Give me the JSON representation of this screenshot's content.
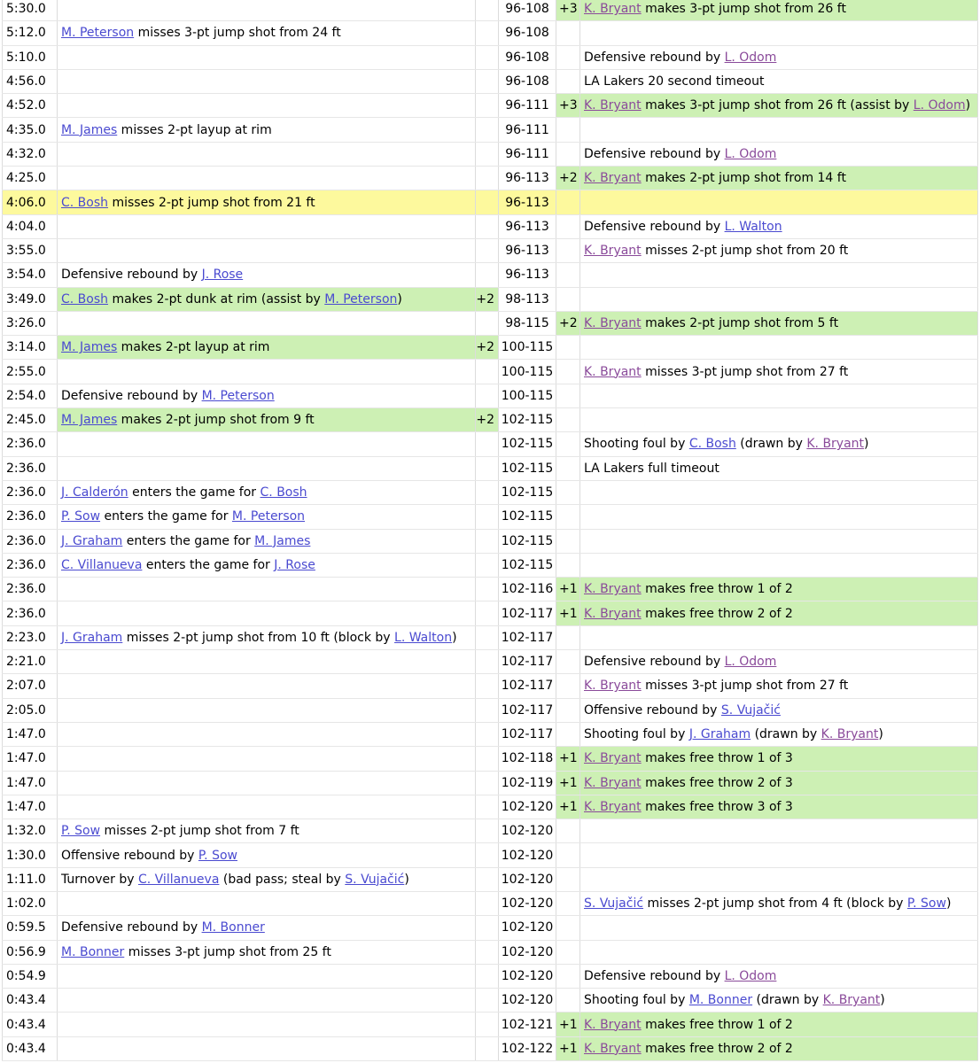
{
  "rows": [
    {
      "time": "5:30.0",
      "away": [],
      "away_pts": "",
      "score": "96-108",
      "home_pts": "+3",
      "home": [
        {
          "p": "K. Bryant",
          "c": "purple"
        },
        {
          "t": " makes 3-pt jump shot from 26 ft"
        }
      ]
    },
    {
      "time": "5:12.0",
      "away": [
        {
          "p": "M. Peterson",
          "c": "blue"
        },
        {
          "t": " misses 3-pt jump shot from 24 ft"
        }
      ],
      "away_pts": "",
      "score": "96-108",
      "home_pts": "",
      "home": []
    },
    {
      "time": "5:10.0",
      "away": [],
      "away_pts": "",
      "score": "96-108",
      "home_pts": "",
      "home": [
        {
          "t": "Defensive rebound by "
        },
        {
          "p": "L. Odom",
          "c": "purple"
        }
      ]
    },
    {
      "time": "4:56.0",
      "away": [],
      "away_pts": "",
      "score": "96-108",
      "home_pts": "",
      "home": [
        {
          "t": "LA Lakers 20 second timeout"
        }
      ]
    },
    {
      "time": "4:52.0",
      "away": [],
      "away_pts": "",
      "score": "96-111",
      "home_pts": "+3",
      "home": [
        {
          "p": "K. Bryant",
          "c": "purple"
        },
        {
          "t": " makes 3-pt jump shot from 26 ft (assist by "
        },
        {
          "p": "L. Odom",
          "c": "purple"
        },
        {
          "t": ")"
        }
      ]
    },
    {
      "time": "4:35.0",
      "away": [
        {
          "p": "M. James",
          "c": "blue"
        },
        {
          "t": " misses 2-pt layup at rim"
        }
      ],
      "away_pts": "",
      "score": "96-111",
      "home_pts": "",
      "home": []
    },
    {
      "time": "4:32.0",
      "away": [],
      "away_pts": "",
      "score": "96-111",
      "home_pts": "",
      "home": [
        {
          "t": "Defensive rebound by "
        },
        {
          "p": "L. Odom",
          "c": "purple"
        }
      ]
    },
    {
      "time": "4:25.0",
      "away": [],
      "away_pts": "",
      "score": "96-113",
      "home_pts": "+2",
      "home": [
        {
          "p": "K. Bryant",
          "c": "purple"
        },
        {
          "t": " makes 2-pt jump shot from 14 ft"
        }
      ]
    },
    {
      "time": "4:06.0",
      "hl": true,
      "away": [
        {
          "p": "C. Bosh",
          "c": "blue"
        },
        {
          "t": " misses 2-pt jump shot from 21 ft"
        }
      ],
      "away_pts": "",
      "score": "96-113",
      "home_pts": "",
      "home": []
    },
    {
      "time": "4:04.0",
      "away": [],
      "away_pts": "",
      "score": "96-113",
      "home_pts": "",
      "home": [
        {
          "t": "Defensive rebound by "
        },
        {
          "p": "L. Walton",
          "c": "blue"
        }
      ]
    },
    {
      "time": "3:55.0",
      "away": [],
      "away_pts": "",
      "score": "96-113",
      "home_pts": "",
      "home": [
        {
          "p": "K. Bryant",
          "c": "purple"
        },
        {
          "t": " misses 2-pt jump shot from 20 ft"
        }
      ]
    },
    {
      "time": "3:54.0",
      "away": [
        {
          "t": "Defensive rebound by "
        },
        {
          "p": "J. Rose",
          "c": "blue"
        }
      ],
      "away_pts": "",
      "score": "96-113",
      "home_pts": "",
      "home": []
    },
    {
      "time": "3:49.0",
      "away": [
        {
          "p": "C. Bosh",
          "c": "blue"
        },
        {
          "t": " makes 2-pt dunk at rim (assist by "
        },
        {
          "p": "M. Peterson",
          "c": "blue"
        },
        {
          "t": ")"
        }
      ],
      "away_pts": "+2",
      "score": "98-113",
      "home_pts": "",
      "home": []
    },
    {
      "time": "3:26.0",
      "away": [],
      "away_pts": "",
      "score": "98-115",
      "home_pts": "+2",
      "home": [
        {
          "p": "K. Bryant",
          "c": "purple"
        },
        {
          "t": " makes 2-pt jump shot from 5 ft"
        }
      ]
    },
    {
      "time": "3:14.0",
      "away": [
        {
          "p": "M. James",
          "c": "blue"
        },
        {
          "t": " makes 2-pt layup at rim"
        }
      ],
      "away_pts": "+2",
      "score": "100-115",
      "home_pts": "",
      "home": []
    },
    {
      "time": "2:55.0",
      "away": [],
      "away_pts": "",
      "score": "100-115",
      "home_pts": "",
      "home": [
        {
          "p": "K. Bryant",
          "c": "purple"
        },
        {
          "t": " misses 3-pt jump shot from 27 ft"
        }
      ]
    },
    {
      "time": "2:54.0",
      "away": [
        {
          "t": "Defensive rebound by "
        },
        {
          "p": "M. Peterson",
          "c": "blue"
        }
      ],
      "away_pts": "",
      "score": "100-115",
      "home_pts": "",
      "home": []
    },
    {
      "time": "2:45.0",
      "away": [
        {
          "p": "M. James",
          "c": "blue"
        },
        {
          "t": " makes 2-pt jump shot from 9 ft"
        }
      ],
      "away_pts": "+2",
      "score": "102-115",
      "home_pts": "",
      "home": []
    },
    {
      "time": "2:36.0",
      "away": [],
      "away_pts": "",
      "score": "102-115",
      "home_pts": "",
      "home": [
        {
          "t": "Shooting foul by "
        },
        {
          "p": "C. Bosh",
          "c": "blue"
        },
        {
          "t": " (drawn by "
        },
        {
          "p": "K. Bryant",
          "c": "purple"
        },
        {
          "t": ")"
        }
      ]
    },
    {
      "time": "2:36.0",
      "away": [],
      "away_pts": "",
      "score": "102-115",
      "home_pts": "",
      "home": [
        {
          "t": "LA Lakers full timeout"
        }
      ]
    },
    {
      "time": "2:36.0",
      "away": [
        {
          "p": "J. Calderón",
          "c": "blue"
        },
        {
          "t": " enters the game for "
        },
        {
          "p": "C. Bosh",
          "c": "blue"
        }
      ],
      "away_pts": "",
      "score": "102-115",
      "home_pts": "",
      "home": []
    },
    {
      "time": "2:36.0",
      "away": [
        {
          "p": "P. Sow",
          "c": "blue"
        },
        {
          "t": " enters the game for "
        },
        {
          "p": "M. Peterson",
          "c": "blue"
        }
      ],
      "away_pts": "",
      "score": "102-115",
      "home_pts": "",
      "home": []
    },
    {
      "time": "2:36.0",
      "away": [
        {
          "p": "J. Graham",
          "c": "blue"
        },
        {
          "t": " enters the game for "
        },
        {
          "p": "M. James",
          "c": "blue"
        }
      ],
      "away_pts": "",
      "score": "102-115",
      "home_pts": "",
      "home": []
    },
    {
      "time": "2:36.0",
      "away": [
        {
          "p": "C. Villanueva",
          "c": "blue"
        },
        {
          "t": " enters the game for "
        },
        {
          "p": "J. Rose",
          "c": "blue"
        }
      ],
      "away_pts": "",
      "score": "102-115",
      "home_pts": "",
      "home": []
    },
    {
      "time": "2:36.0",
      "away": [],
      "away_pts": "",
      "score": "102-116",
      "home_pts": "+1",
      "home": [
        {
          "p": "K. Bryant",
          "c": "purple"
        },
        {
          "t": " makes free throw 1 of 2"
        }
      ]
    },
    {
      "time": "2:36.0",
      "away": [],
      "away_pts": "",
      "score": "102-117",
      "home_pts": "+1",
      "home": [
        {
          "p": "K. Bryant",
          "c": "purple"
        },
        {
          "t": " makes free throw 2 of 2"
        }
      ]
    },
    {
      "time": "2:23.0",
      "away": [
        {
          "p": "J. Graham",
          "c": "blue"
        },
        {
          "t": " misses 2-pt jump shot from 10 ft (block by "
        },
        {
          "p": "L. Walton",
          "c": "blue"
        },
        {
          "t": ")"
        }
      ],
      "away_pts": "",
      "score": "102-117",
      "home_pts": "",
      "home": []
    },
    {
      "time": "2:21.0",
      "away": [],
      "away_pts": "",
      "score": "102-117",
      "home_pts": "",
      "home": [
        {
          "t": "Defensive rebound by "
        },
        {
          "p": "L. Odom",
          "c": "purple"
        }
      ]
    },
    {
      "time": "2:07.0",
      "away": [],
      "away_pts": "",
      "score": "102-117",
      "home_pts": "",
      "home": [
        {
          "p": "K. Bryant",
          "c": "purple"
        },
        {
          "t": " misses 3-pt jump shot from 27 ft"
        }
      ]
    },
    {
      "time": "2:05.0",
      "away": [],
      "away_pts": "",
      "score": "102-117",
      "home_pts": "",
      "home": [
        {
          "t": "Offensive rebound by "
        },
        {
          "p": "S. Vujačić",
          "c": "blue"
        }
      ]
    },
    {
      "time": "1:47.0",
      "away": [],
      "away_pts": "",
      "score": "102-117",
      "home_pts": "",
      "home": [
        {
          "t": "Shooting foul by "
        },
        {
          "p": "J. Graham",
          "c": "blue"
        },
        {
          "t": " (drawn by "
        },
        {
          "p": "K. Bryant",
          "c": "purple"
        },
        {
          "t": ")"
        }
      ]
    },
    {
      "time": "1:47.0",
      "away": [],
      "away_pts": "",
      "score": "102-118",
      "home_pts": "+1",
      "home": [
        {
          "p": "K. Bryant",
          "c": "purple"
        },
        {
          "t": " makes free throw 1 of 3"
        }
      ]
    },
    {
      "time": "1:47.0",
      "away": [],
      "away_pts": "",
      "score": "102-119",
      "home_pts": "+1",
      "home": [
        {
          "p": "K. Bryant",
          "c": "purple"
        },
        {
          "t": " makes free throw 2 of 3"
        }
      ]
    },
    {
      "time": "1:47.0",
      "away": [],
      "away_pts": "",
      "score": "102-120",
      "home_pts": "+1",
      "home": [
        {
          "p": "K. Bryant",
          "c": "purple"
        },
        {
          "t": " makes free throw 3 of 3"
        }
      ]
    },
    {
      "time": "1:32.0",
      "away": [
        {
          "p": "P. Sow",
          "c": "blue"
        },
        {
          "t": " misses 2-pt jump shot from 7 ft"
        }
      ],
      "away_pts": "",
      "score": "102-120",
      "home_pts": "",
      "home": []
    },
    {
      "time": "1:30.0",
      "away": [
        {
          "t": "Offensive rebound by "
        },
        {
          "p": "P. Sow",
          "c": "blue"
        }
      ],
      "away_pts": "",
      "score": "102-120",
      "home_pts": "",
      "home": []
    },
    {
      "time": "1:11.0",
      "away": [
        {
          "t": "Turnover by "
        },
        {
          "p": "C. Villanueva",
          "c": "blue"
        },
        {
          "t": " (bad pass; steal by "
        },
        {
          "p": "S. Vujačić",
          "c": "blue"
        },
        {
          "t": ")"
        }
      ],
      "away_pts": "",
      "score": "102-120",
      "home_pts": "",
      "home": []
    },
    {
      "time": "1:02.0",
      "away": [],
      "away_pts": "",
      "score": "102-120",
      "home_pts": "",
      "home": [
        {
          "p": "S. Vujačić",
          "c": "blue"
        },
        {
          "t": " misses 2-pt jump shot from 4 ft (block by "
        },
        {
          "p": "P. Sow",
          "c": "blue"
        },
        {
          "t": ")"
        }
      ]
    },
    {
      "time": "0:59.5",
      "away": [
        {
          "t": "Defensive rebound by "
        },
        {
          "p": "M. Bonner",
          "c": "blue"
        }
      ],
      "away_pts": "",
      "score": "102-120",
      "home_pts": "",
      "home": []
    },
    {
      "time": "0:56.9",
      "away": [
        {
          "p": "M. Bonner",
          "c": "blue"
        },
        {
          "t": " misses 3-pt jump shot from 25 ft"
        }
      ],
      "away_pts": "",
      "score": "102-120",
      "home_pts": "",
      "home": []
    },
    {
      "time": "0:54.9",
      "away": [],
      "away_pts": "",
      "score": "102-120",
      "home_pts": "",
      "home": [
        {
          "t": "Defensive rebound by "
        },
        {
          "p": "L. Odom",
          "c": "purple"
        }
      ]
    },
    {
      "time": "0:43.4",
      "away": [],
      "away_pts": "",
      "score": "102-120",
      "home_pts": "",
      "home": [
        {
          "t": "Shooting foul by "
        },
        {
          "p": "M. Bonner",
          "c": "blue"
        },
        {
          "t": " (drawn by "
        },
        {
          "p": "K. Bryant",
          "c": "purple"
        },
        {
          "t": ")"
        }
      ]
    },
    {
      "time": "0:43.4",
      "away": [],
      "away_pts": "",
      "score": "102-121",
      "home_pts": "+1",
      "home": [
        {
          "p": "K. Bryant",
          "c": "purple"
        },
        {
          "t": " makes free throw 1 of 2"
        }
      ]
    },
    {
      "time": "0:43.4",
      "away": [],
      "away_pts": "",
      "score": "102-122",
      "home_pts": "+1",
      "home": [
        {
          "p": "K. Bryant",
          "c": "purple"
        },
        {
          "t": " makes free throw 2 of 2"
        }
      ]
    }
  ],
  "colors": {
    "scoring_row_bg": "#cdf0b4",
    "highlight_row_bg": "#fdf99d",
    "link_blue": "#4a4ad0",
    "link_visited_purple": "#8a4a9a"
  }
}
